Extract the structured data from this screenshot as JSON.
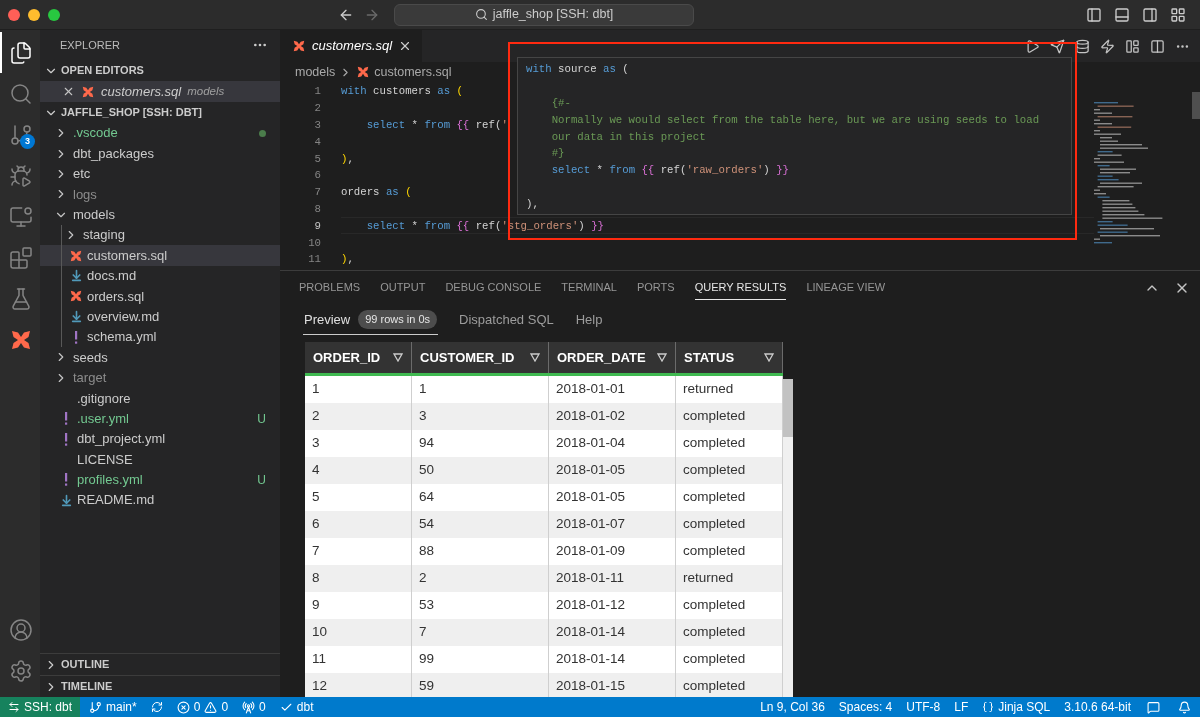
{
  "window": {
    "title": "jaffle_shop [SSH: dbt]"
  },
  "activity_bar": {
    "items": [
      {
        "kind": "explorer",
        "selected": true
      },
      {
        "kind": "search",
        "selected": false
      },
      {
        "kind": "source-control",
        "selected": false,
        "badge": "3"
      },
      {
        "kind": "run",
        "selected": false
      },
      {
        "kind": "remote",
        "selected": false
      },
      {
        "kind": "extensions",
        "selected": false
      },
      {
        "kind": "testing",
        "selected": false
      },
      {
        "kind": "dbt",
        "selected": false
      }
    ],
    "bottom": [
      {
        "kind": "account"
      },
      {
        "kind": "settings"
      }
    ]
  },
  "sidebar": {
    "title": "EXPLORER",
    "open_editors": {
      "title": "OPEN EDITORS",
      "expanded": true,
      "items": [
        {
          "name": "customers.sql",
          "description": "models",
          "kind": "dbt-file",
          "selected": true
        }
      ]
    },
    "folder": {
      "title": "JAFFLE_SHOP [SSH: DBT]",
      "expanded": true,
      "items": [
        {
          "name": ".vscode",
          "kind": "folder",
          "expanded": false,
          "selected": false,
          "color": "#73c991",
          "dot": true
        },
        {
          "name": "dbt_packages",
          "kind": "folder",
          "expanded": false,
          "selected": false,
          "color": "#cccccc",
          "dot": false
        },
        {
          "name": "etc",
          "kind": "folder",
          "expanded": false,
          "selected": false,
          "color": "#cccccc",
          "dot": false
        },
        {
          "name": "logs",
          "kind": "folder",
          "expanded": false,
          "selected": false,
          "color": "#8c8c8c",
          "dot": false
        },
        {
          "name": "models",
          "kind": "folder",
          "expanded": true,
          "selected": false,
          "color": "#cccccc",
          "dot": false,
          "children": [
            {
              "name": "staging",
              "kind": "folder",
              "expanded": false,
              "selected": false,
              "color": "#cccccc",
              "dot": false
            },
            {
              "name": "customers.sql",
              "kind": "dbt-file",
              "selected": true,
              "color": "#cccccc",
              "dot": false
            },
            {
              "name": "docs.md",
              "kind": "markdown-file",
              "selected": false,
              "color": "#cccccc",
              "dot": false
            },
            {
              "name": "orders.sql",
              "kind": "dbt-file",
              "selected": false,
              "color": "#cccccc",
              "dot": false
            },
            {
              "name": "overview.md",
              "kind": "markdown-file",
              "selected": false,
              "color": "#cccccc",
              "dot": false
            },
            {
              "name": "schema.yml",
              "kind": "yaml-file",
              "selected": false,
              "color": "#cccccc",
              "dot": false
            }
          ]
        },
        {
          "name": "seeds",
          "kind": "folder",
          "expanded": false,
          "selected": false,
          "color": "#cccccc",
          "dot": false
        },
        {
          "name": "target",
          "kind": "folder",
          "expanded": false,
          "selected": false,
          "color": "#8c8c8c",
          "dot": false
        },
        {
          "name": ".gitignore",
          "kind": "file",
          "selected": false,
          "color": "#cccccc",
          "dot": false
        },
        {
          "name": ".user.yml",
          "kind": "yaml-file",
          "selected": false,
          "color": "#73c991",
          "dot": false,
          "status": "U"
        },
        {
          "name": "dbt_project.yml",
          "kind": "yaml-file",
          "selected": false,
          "color": "#cccccc",
          "dot": false
        },
        {
          "name": "LICENSE",
          "kind": "file",
          "selected": false,
          "color": "#cccccc",
          "dot": false
        },
        {
          "name": "profiles.yml",
          "kind": "yaml-file",
          "selected": false,
          "color": "#73c991",
          "dot": false,
          "status": "U"
        },
        {
          "name": "README.md",
          "kind": "markdown-file",
          "selected": false,
          "color": "#cccccc",
          "dot": false
        }
      ]
    },
    "collapsed_sections": [
      {
        "title": "OUTLINE",
        "expanded": false
      },
      {
        "title": "TIMELINE",
        "expanded": false
      }
    ]
  },
  "editor": {
    "tabs": [
      {
        "name": "customers.sql",
        "kind": "dbt-file",
        "selected": true
      }
    ],
    "breadcrumb": [
      {
        "text": "models",
        "kind": "folder"
      },
      {
        "text": "customers.sql",
        "kind": "dbt-file"
      }
    ],
    "lines": [
      {
        "number": "1",
        "current": false,
        "tokens": [
          {
            "text": "with",
            "kind": "keyword"
          },
          {
            "text": " customers ",
            "kind": "plain"
          },
          {
            "text": "as",
            "kind": "keyword"
          },
          {
            "text": " (",
            "kind": "paren"
          }
        ]
      },
      {
        "number": "2",
        "current": false
      },
      {
        "number": "3",
        "current": false,
        "tokens": [
          {
            "text": "    select",
            "kind": "keyword"
          },
          {
            "text": " * ",
            "kind": "plain"
          },
          {
            "text": "from",
            "kind": "keyword"
          },
          {
            "text": " {{",
            "kind": "jinja"
          },
          {
            "text": " ref(",
            "kind": "plain"
          },
          {
            "text": "'",
            "kind": "string"
          }
        ]
      },
      {
        "number": "4",
        "current": false
      },
      {
        "number": "5",
        "current": false,
        "tokens": [
          {
            "text": ")",
            "kind": "paren"
          },
          {
            "text": ",",
            "kind": "plain"
          }
        ]
      },
      {
        "number": "6",
        "current": false
      },
      {
        "number": "7",
        "current": false,
        "tokens": [
          {
            "text": "orders ",
            "kind": "plain"
          },
          {
            "text": "as",
            "kind": "keyword"
          },
          {
            "text": " (",
            "kind": "paren"
          }
        ]
      },
      {
        "number": "8",
        "current": false
      },
      {
        "number": "9",
        "current": true,
        "tokens": [
          {
            "text": "    select",
            "kind": "keyword"
          },
          {
            "text": " * ",
            "kind": "plain"
          },
          {
            "text": "from",
            "kind": "keyword"
          },
          {
            "text": " {{",
            "kind": "jinja"
          },
          {
            "text": " ref(",
            "kind": "plain"
          },
          {
            "text": "'stg_orders'",
            "kind": "string"
          },
          {
            "text": ") ",
            "kind": "plain"
          },
          {
            "text": "}}",
            "kind": "jinja"
          }
        ]
      },
      {
        "number": "10",
        "current": false
      },
      {
        "number": "11",
        "current": false,
        "tokens": [
          {
            "text": ")",
            "kind": "paren"
          },
          {
            "text": ",",
            "kind": "plain"
          }
        ]
      }
    ],
    "hover": {
      "lines": [
        {
          "kind": "code",
          "tokens": [
            {
              "text": "with",
              "kind": "keyword"
            },
            {
              "text": " source ",
              "kind": "plain"
            },
            {
              "text": "as",
              "kind": "keyword"
            },
            {
              "text": " (",
              "kind": "plain"
            }
          ]
        },
        {
          "kind": "blank"
        },
        {
          "kind": "code",
          "tokens": [
            {
              "text": "    {#-",
              "kind": "comment"
            }
          ]
        },
        {
          "kind": "code",
          "tokens": [
            {
              "text": "    Normally we would select from the table here, but we are using seeds to load",
              "kind": "comment"
            }
          ]
        },
        {
          "kind": "code",
          "tokens": [
            {
              "text": "    our data in this project",
              "kind": "comment"
            }
          ]
        },
        {
          "kind": "code",
          "tokens": [
            {
              "text": "    #}",
              "kind": "comment"
            }
          ]
        },
        {
          "kind": "code",
          "tokens": [
            {
              "text": "    select",
              "kind": "keyword"
            },
            {
              "text": " * ",
              "kind": "plain"
            },
            {
              "text": "from",
              "kind": "keyword"
            },
            {
              "text": " {{",
              "kind": "jinja"
            },
            {
              "text": " ref(",
              "kind": "plain"
            },
            {
              "text": "'raw_orders'",
              "kind": "string"
            },
            {
              "text": ") ",
              "kind": "plain"
            },
            {
              "text": "}}",
              "kind": "jinja"
            }
          ]
        },
        {
          "kind": "blank"
        },
        {
          "kind": "code",
          "tokens": [
            {
              "text": "),",
              "kind": "plain"
            }
          ]
        }
      ]
    }
  },
  "panel": {
    "tabs": [
      {
        "label": "PROBLEMS",
        "selected": false
      },
      {
        "label": "OUTPUT",
        "selected": false
      },
      {
        "label": "DEBUG CONSOLE",
        "selected": false
      },
      {
        "label": "TERMINAL",
        "selected": false
      },
      {
        "label": "PORTS",
        "selected": false
      },
      {
        "label": "QUERY RESULTS",
        "selected": true
      },
      {
        "label": "LINEAGE VIEW",
        "selected": false
      }
    ],
    "subtabs": [
      {
        "label": "Preview",
        "selected": true,
        "badge": "99 rows in 0s"
      },
      {
        "label": "Dispatched SQL",
        "selected": false
      },
      {
        "label": "Help",
        "selected": false
      }
    ],
    "table": {
      "columns": [
        "ORDER_ID",
        "CUSTOMER_ID",
        "ORDER_DATE",
        "STATUS"
      ],
      "rows": [
        [
          "1",
          "1",
          "2018-01-01",
          "returned"
        ],
        [
          "2",
          "3",
          "2018-01-02",
          "completed"
        ],
        [
          "3",
          "94",
          "2018-01-04",
          "completed"
        ],
        [
          "4",
          "50",
          "2018-01-05",
          "completed"
        ],
        [
          "5",
          "64",
          "2018-01-05",
          "completed"
        ],
        [
          "6",
          "54",
          "2018-01-07",
          "completed"
        ],
        [
          "7",
          "88",
          "2018-01-09",
          "completed"
        ],
        [
          "8",
          "2",
          "2018-01-11",
          "returned"
        ],
        [
          "9",
          "53",
          "2018-01-12",
          "completed"
        ],
        [
          "10",
          "7",
          "2018-01-14",
          "completed"
        ],
        [
          "11",
          "99",
          "2018-01-14",
          "completed"
        ],
        [
          "12",
          "59",
          "2018-01-15",
          "completed"
        ]
      ]
    }
  },
  "status_bar": {
    "left": [
      {
        "kind": "remote",
        "text": "SSH: dbt"
      },
      {
        "kind": "branch",
        "text": "main*"
      },
      {
        "kind": "sync"
      },
      {
        "kind": "problems",
        "errors": "0",
        "warnings": "0"
      },
      {
        "kind": "ports",
        "text": "0"
      },
      {
        "kind": "check",
        "text": "dbt"
      }
    ],
    "right": [
      {
        "kind": "text",
        "text": "Ln 9, Col 36"
      },
      {
        "kind": "text",
        "text": "Spaces: 4"
      },
      {
        "kind": "text",
        "text": "UTF-8"
      },
      {
        "kind": "text",
        "text": "LF"
      },
      {
        "kind": "language",
        "text": "Jinja SQL"
      },
      {
        "kind": "text",
        "text": "3.10.6 64-bit"
      },
      {
        "kind": "feedback"
      },
      {
        "kind": "bell"
      }
    ]
  }
}
